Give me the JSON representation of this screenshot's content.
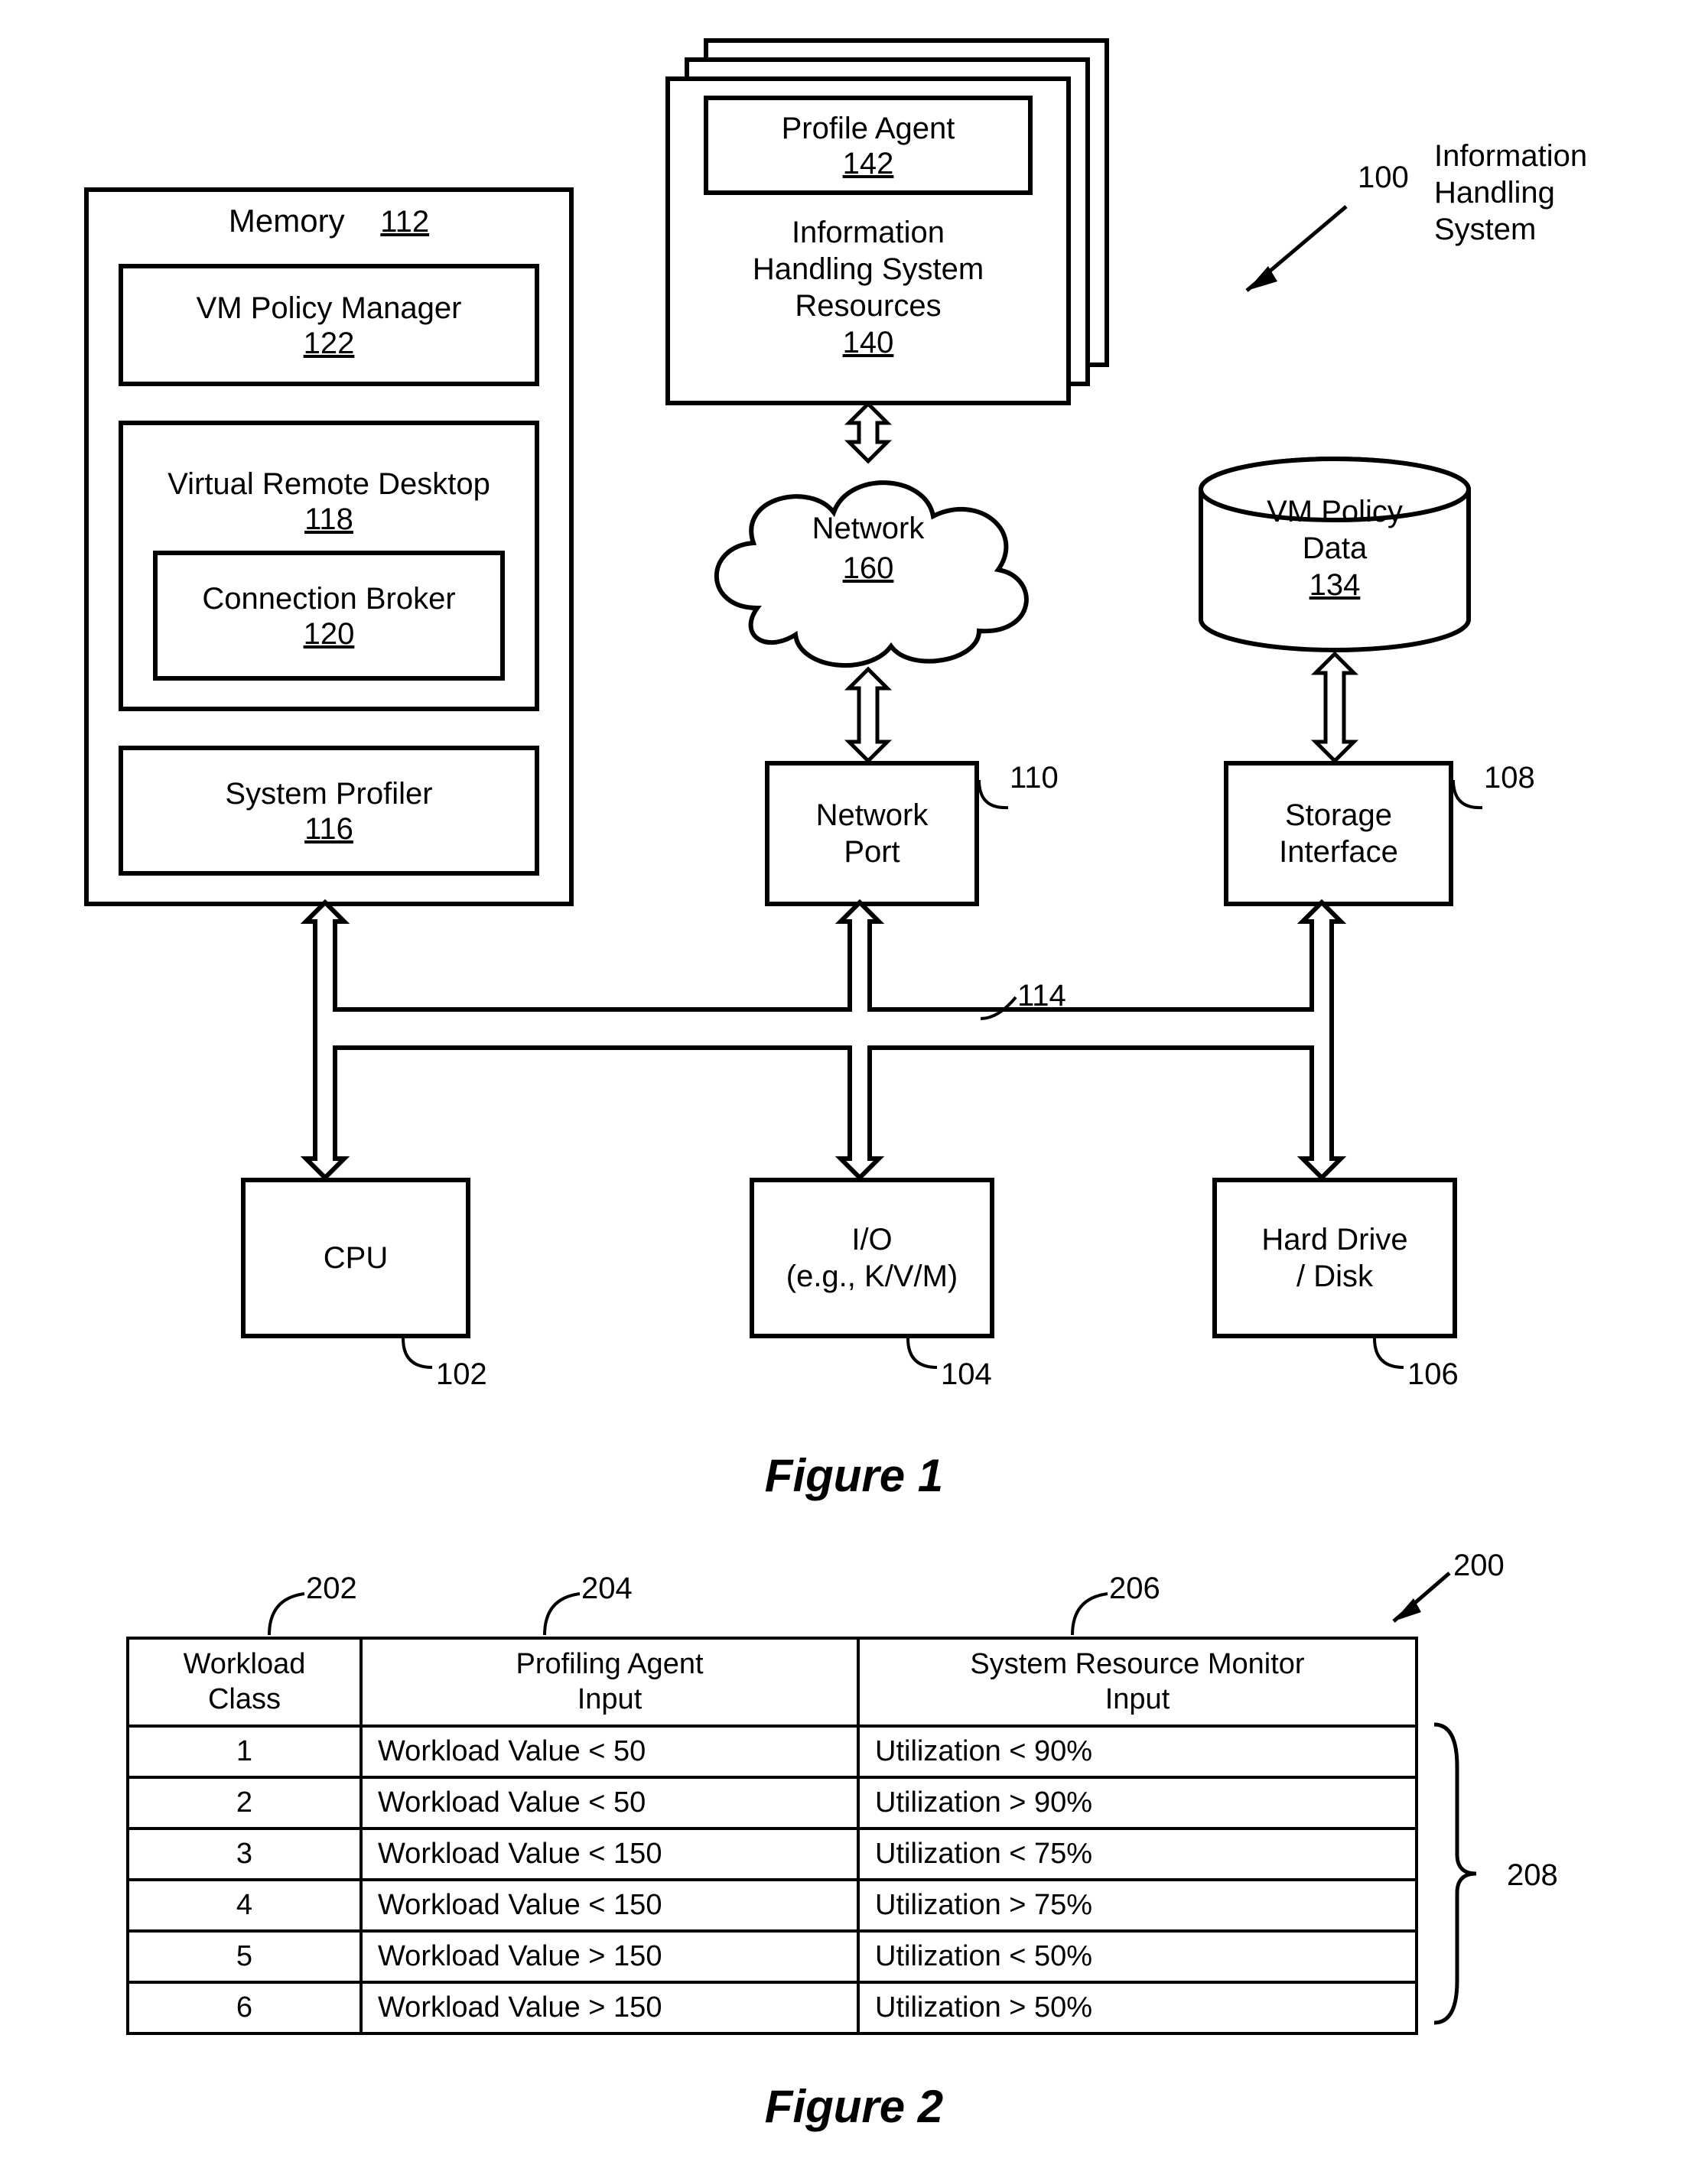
{
  "fig1": {
    "memory_title": "Memory",
    "memory_num": "112",
    "vm_policy": {
      "label": "VM Policy Manager",
      "num": "122"
    },
    "vrd": {
      "label": "Virtual Remote Desktop",
      "num": "118"
    },
    "conn": {
      "label": "Connection Broker",
      "num": "120"
    },
    "sys_prof": {
      "label": "System Profiler",
      "num": "116"
    },
    "profile_agent": {
      "label": "Profile Agent",
      "num": "142"
    },
    "ihsr": {
      "label": "Information\nHandling System\nResources",
      "num": "140"
    },
    "network": {
      "label": "Network",
      "num": "160"
    },
    "vm_policy_data": {
      "label": "VM Policy\nData",
      "num": "134"
    },
    "net_port": {
      "label": "Network\nPort",
      "ref": "110"
    },
    "storage": {
      "label": "Storage\nInterface",
      "ref": "108"
    },
    "cpu": {
      "label": "CPU",
      "ref": "102"
    },
    "io": {
      "label": "I/O\n(e.g., K/V/M)",
      "ref": "104"
    },
    "disk": {
      "label": "Hard Drive\n/ Disk",
      "ref": "106"
    },
    "bus_ref": "114",
    "main_ref": "100",
    "main_label": "Information\nHandling\nSystem",
    "caption": "Figure 1"
  },
  "fig2": {
    "ref_main": "200",
    "col_refs": [
      "202",
      "204",
      "206"
    ],
    "brace_ref": "208",
    "headers": [
      "Workload\nClass",
      "Profiling Agent\nInput",
      "System Resource Monitor\nInput"
    ],
    "rows": [
      {
        "class": "1",
        "agent": "Workload Value < 50",
        "res": "Utilization < 90%"
      },
      {
        "class": "2",
        "agent": "Workload Value < 50",
        "res": "Utilization > 90%"
      },
      {
        "class": "3",
        "agent": "Workload Value < 150",
        "res": "Utilization < 75%"
      },
      {
        "class": "4",
        "agent": "Workload Value < 150",
        "res": "Utilization > 75%"
      },
      {
        "class": "5",
        "agent": "Workload Value > 150",
        "res": "Utilization < 50%"
      },
      {
        "class": "6",
        "agent": "Workload Value > 150",
        "res": "Utilization > 50%"
      }
    ],
    "caption": "Figure 2"
  }
}
